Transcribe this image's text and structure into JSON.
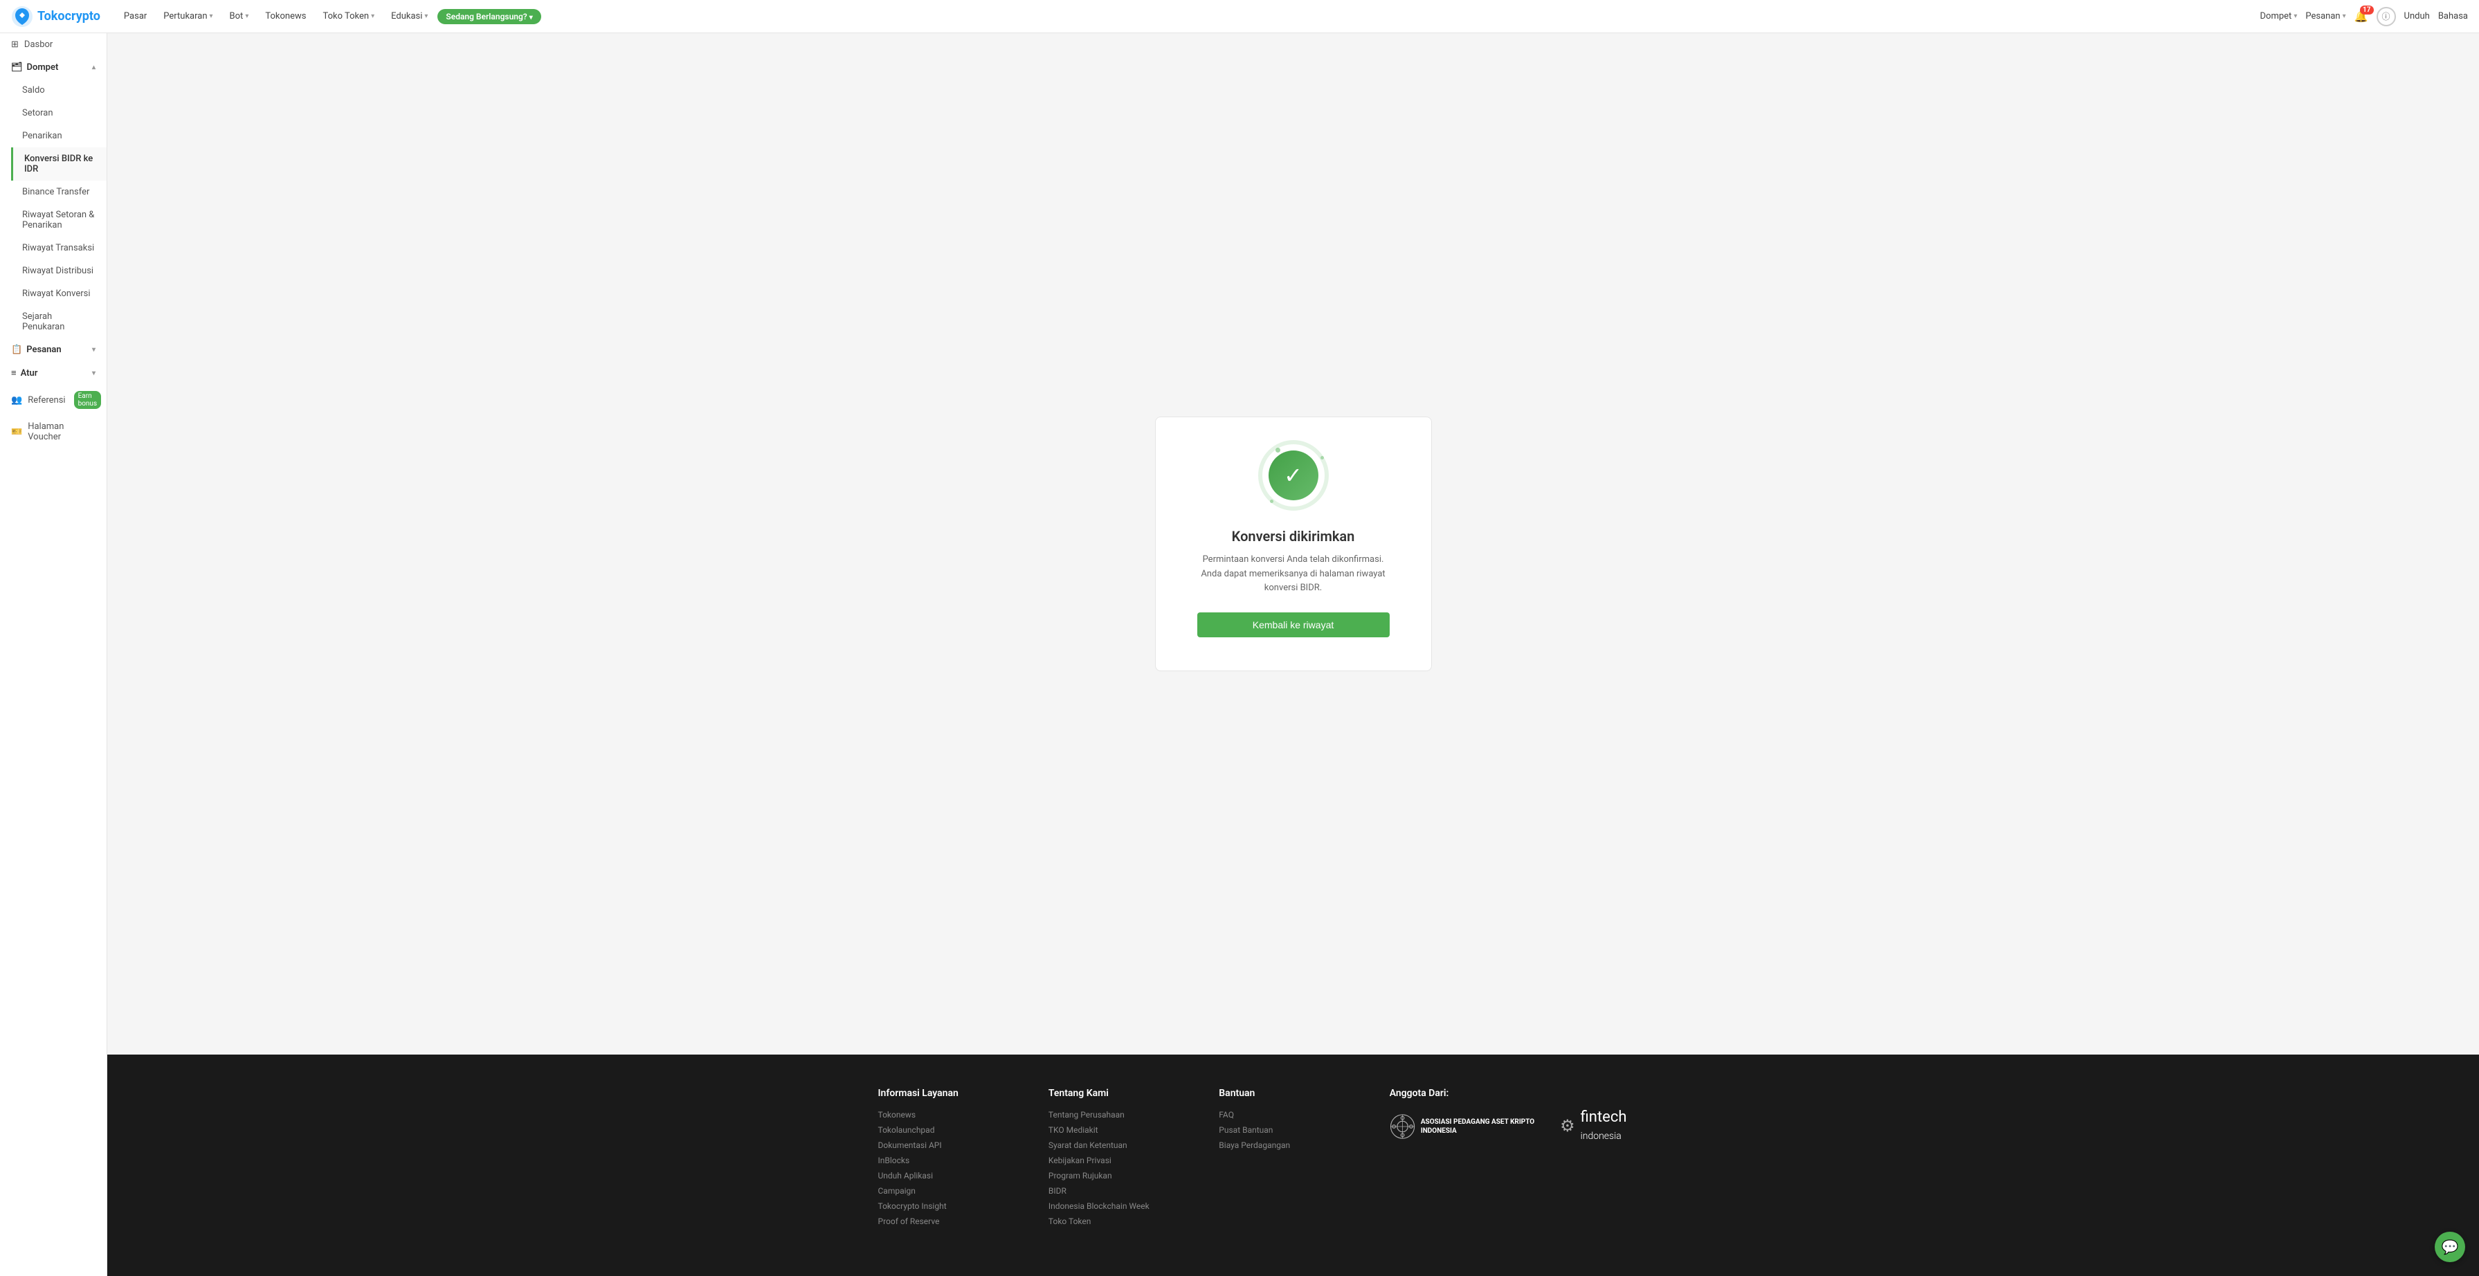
{
  "brand": {
    "name": "Tokocrypto",
    "logo_text": "Tokocrypto"
  },
  "topnav": {
    "items": [
      {
        "label": "Pasar",
        "has_dropdown": false
      },
      {
        "label": "Pertukaran",
        "has_dropdown": true
      },
      {
        "label": "Bot",
        "has_dropdown": true
      },
      {
        "label": "Tokonews",
        "has_dropdown": false
      },
      {
        "label": "Toko Token",
        "has_dropdown": true
      },
      {
        "label": "Edukasi",
        "has_dropdown": true
      }
    ],
    "live_badge": "Sedang Berlangsung?",
    "right": {
      "dompet": "Dompet",
      "pesanan": "Pesanan",
      "notif_count": "17",
      "unduh": "Unduh",
      "bahasa": "Bahasa"
    }
  },
  "sidebar": {
    "dasbor_label": "Dasbor",
    "dompet_label": "Dompet",
    "items_dompet": [
      {
        "label": "Saldo",
        "active": false
      },
      {
        "label": "Setoran",
        "active": false
      },
      {
        "label": "Penarikan",
        "active": false
      },
      {
        "label": "Konversi BIDR ke IDR",
        "active": true
      },
      {
        "label": "Binance Transfer",
        "active": false
      },
      {
        "label": "Riwayat Setoran & Penarikan",
        "active": false
      },
      {
        "label": "Riwayat Transaksi",
        "active": false
      },
      {
        "label": "Riwayat Distribusi",
        "active": false
      },
      {
        "label": "Riwayat Konversi",
        "active": false
      },
      {
        "label": "Sejarah Penukaran",
        "active": false
      }
    ],
    "pesanan_label": "Pesanan",
    "atur_label": "Atur",
    "referensi_label": "Referensi",
    "referensi_badge": "Earn bonus",
    "halaman_voucher_label": "Halaman Voucher"
  },
  "main": {
    "success": {
      "title": "Konversi dikirimkan",
      "description": "Permintaan konversi Anda telah dikonfirmasi. Anda dapat memeriksanya di halaman riwayat konversi BIDR.",
      "button": "Kembali ke riwayat"
    }
  },
  "footer": {
    "col1": {
      "title": "Informasi Layanan",
      "links": [
        "Tokonews",
        "Tokolaunchpad",
        "Dokumentasi API",
        "InBlocks",
        "Unduh Aplikasi",
        "Campaign",
        "Tokocrypto Insight",
        "Proof of Reserve"
      ]
    },
    "col2": {
      "title": "Tentang Kami",
      "links": [
        "Tentang Perusahaan",
        "TKO Mediakit",
        "Syarat dan Ketentuan",
        "Kebijakan Privasi",
        "Program Rujukan",
        "BIDR",
        "Indonesia Blockchain Week",
        "Toko Token"
      ]
    },
    "col3": {
      "title": "Bantuan",
      "links": [
        "FAQ",
        "Pusat Bantuan",
        "Biaya Perdagangan"
      ]
    },
    "col4": {
      "title": "Anggota Dari:",
      "assoc1": "ASOSIASI PEDAGANG ASET KRIPTO INDONESIA",
      "assoc2": "fintech indonesia"
    }
  },
  "float_chat_icon": "💬"
}
